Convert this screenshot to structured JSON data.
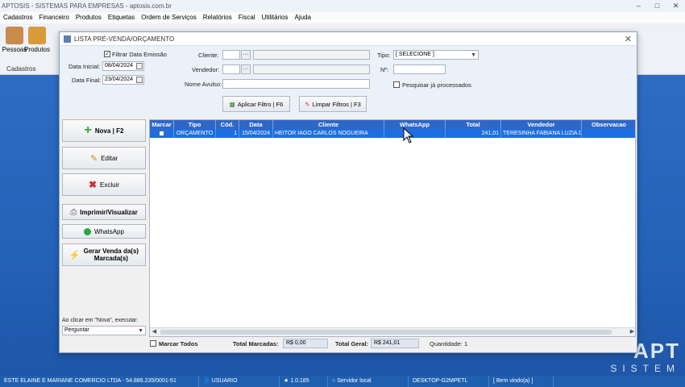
{
  "app": {
    "title": "APTOSIS - SISTEMAS PARA EMPRESAS - aptosis.com.br",
    "menu": [
      "Cadastros",
      "Financeiro",
      "Produtos",
      "Etiquetas",
      "Ordem de Serviços",
      "Relatórios",
      "Fiscal",
      "Utilitários",
      "Ajuda"
    ],
    "ribbon": {
      "buttons": [
        "Pessoas",
        "Produtos"
      ],
      "group_label": "Cadastros"
    },
    "brand": {
      "main": "APT",
      "sub": "SISTEM"
    }
  },
  "status_bar": {
    "company": "ESTE ELAINE E MARIANE COMERCIO LTDA - 54.886.235/0001-51",
    "user": "USUARIO",
    "version": "1.0.185",
    "server": "Servidor local",
    "machine": "DESKTOP-G2MPETL",
    "welcome": "[ Bem vindo(a) ]"
  },
  "dialog": {
    "title": "LISTA PRÉ-VENDA/ORÇAMENTO",
    "filters": {
      "filter_date_label": "Filtrar Data Emissão",
      "date_start_label": "Data Inicial:",
      "date_start": "08/04/2024",
      "date_end_label": "Data Final:",
      "date_end": "23/04/2024",
      "client_label": "Cliente:",
      "seller_label": "Vendedor:",
      "walk_in_label": "Nome Avulso:",
      "type_label": "Tipo:",
      "type_value": "[ SELECIONE ]",
      "number_label": "Nº:",
      "processed_label": "Pesquisar já processados",
      "apply_button": "Aplicar Filtro | F6",
      "clear_button": "Limpar Filtros | F3"
    },
    "actions": {
      "new": "Nova | F2",
      "edit": "Editar",
      "delete": "Excluir",
      "print": "Imprimir/Visualizar",
      "whatsapp": "WhatsApp",
      "generate_line1": "Gerar Venda da(s)",
      "generate_line2": "Marcada(s)"
    },
    "on_new_label": "Ao clicar em \"Nova\", executar:",
    "on_new_value": "Perguntar",
    "grid": {
      "columns": [
        "Marcar",
        "Tipo",
        "Cód.",
        "Data",
        "Cliente",
        "WhatsApp",
        "Total",
        "Vendedor",
        "Observacao"
      ],
      "rows": [
        {
          "tipo": "ORÇAMENTO",
          "cod": "1",
          "data": "15/04/2024",
          "cliente": "HEITOR IAGO CARLOS NOGUEIRA",
          "whatsapp": "",
          "total": "241,01",
          "vendedor": "TERESINHA FABIANA LUZIA DE",
          "obs": ""
        }
      ]
    },
    "footer": {
      "mark_all": "Marcar Todos",
      "total_marked_label": "Total Marcadas:",
      "total_marked_value": "R$ 0,00",
      "grand_total_label": "Total Geral:",
      "grand_total_value": "R$ 241,01",
      "quantity_label": "Quantidade:",
      "quantity_value": "1"
    }
  }
}
